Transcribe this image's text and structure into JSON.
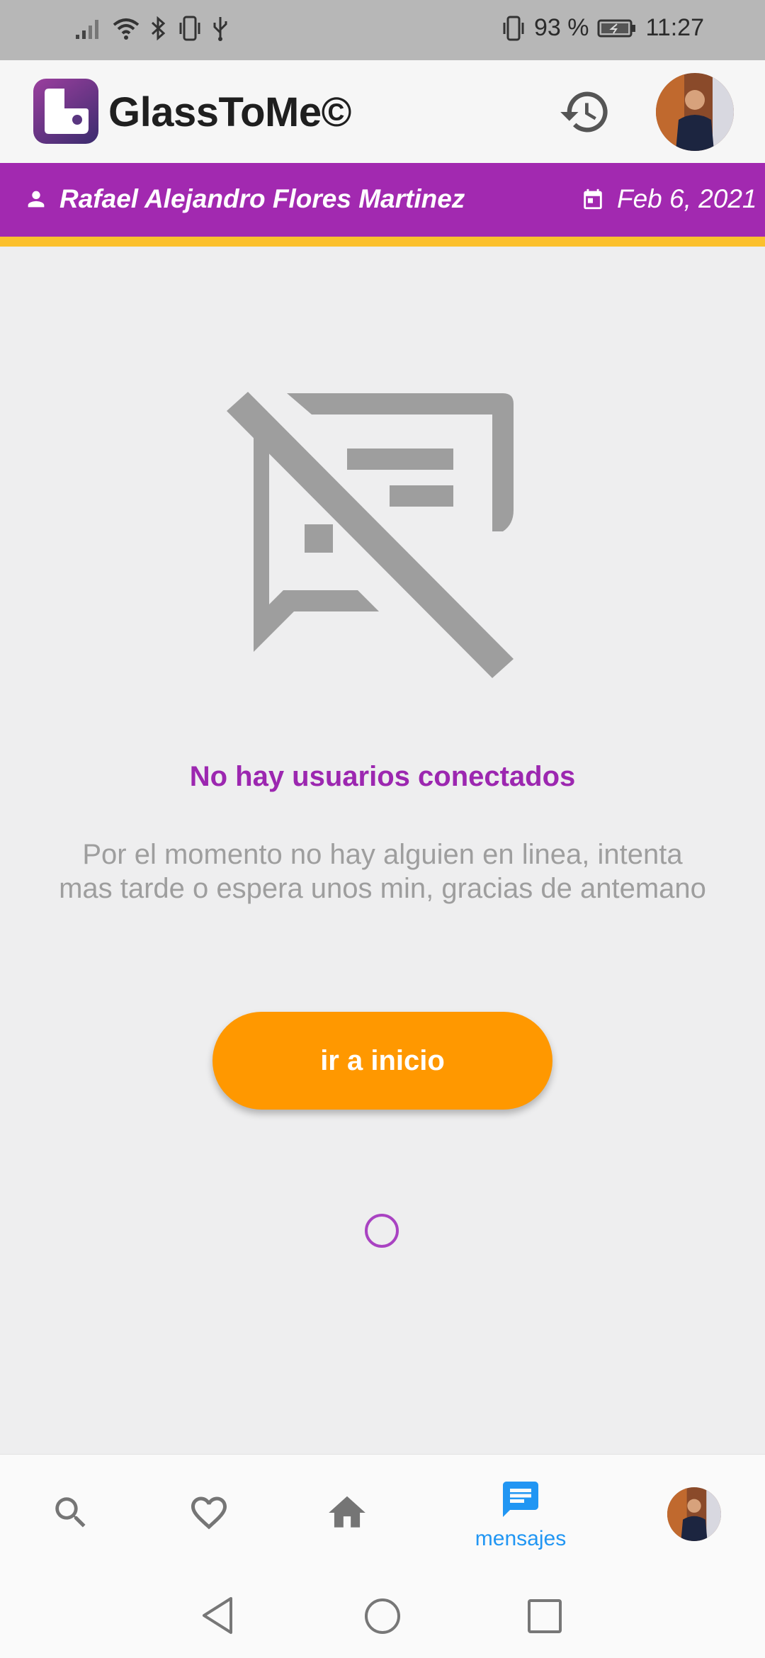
{
  "status_bar": {
    "battery": "93 %",
    "time": "11:27",
    "icons": [
      "signal-icon",
      "wifi-icon",
      "bluetooth-icon",
      "vibrate-icon",
      "usb-icon",
      "battery-charging-icon"
    ]
  },
  "app_bar": {
    "title": "GlassToMe©",
    "actions": [
      "history-icon",
      "avatar"
    ]
  },
  "user_bar": {
    "name": "Rafael Alejandro Flores Martinez",
    "date": "Feb 6, 2021",
    "colors": {
      "background": "#a229b0",
      "stripe": "#fbc02d"
    }
  },
  "empty_state": {
    "icon": "speaker-notes-off-icon",
    "title": "No hay usuarios conectados",
    "message_line1": "Por el momento no hay alguien en linea, intenta",
    "message_line2": "mas tarde o espera unos min, gracias de antemano",
    "button_label": "ir a inicio",
    "colors": {
      "title": "#9c27b0",
      "button": "#ff9800"
    }
  },
  "bottom_nav": {
    "items": [
      {
        "icon": "search-icon"
      },
      {
        "icon": "heart-icon"
      },
      {
        "icon": "home-icon"
      },
      {
        "icon": "chat-icon",
        "label": "mensajes",
        "active": true
      },
      {
        "icon": "avatar"
      }
    ],
    "active_color": "#2196f3"
  },
  "system_nav": {
    "icons": [
      "back-icon",
      "home-circle-icon",
      "recents-icon"
    ]
  }
}
